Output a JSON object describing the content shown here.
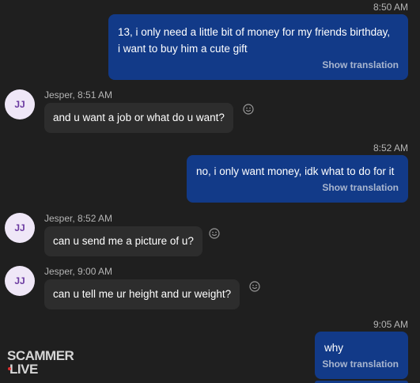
{
  "messages": [
    {
      "type": "timestamp",
      "text": "8:50 AM"
    },
    {
      "type": "outgoing",
      "text": "13, i only need a little bit of money for my friends birthday,\ni want to buy him a cute gift",
      "translation": "Show translation"
    },
    {
      "type": "incoming",
      "sender_meta": "Jesper, 8:51 AM",
      "avatar": "JJ",
      "text": "and u want a job or what do u want?"
    },
    {
      "type": "timestamp",
      "text": "8:52 AM"
    },
    {
      "type": "outgoing",
      "text": "no, i only want money, idk what to do for it",
      "translation": "Show translation"
    },
    {
      "type": "incoming",
      "sender_meta": "Jesper, 8:52 AM",
      "avatar": "JJ",
      "text": "can u send me a picture of u?"
    },
    {
      "type": "incoming",
      "sender_meta": "Jesper, 9:00 AM",
      "avatar": "JJ",
      "text": "can u tell me ur height and ur weight?"
    },
    {
      "type": "timestamp",
      "text": "9:05 AM"
    },
    {
      "type": "outgoing",
      "text": "why",
      "translation": "Show translation"
    }
  ],
  "watermark": {
    "line1": "SCAMMER",
    "line2": "LIVE"
  },
  "colors": {
    "background": "#1f1f1f",
    "outgoing_bubble": "#123a88",
    "incoming_bubble": "#2d2d2d",
    "avatar_bg": "#efe7f7",
    "avatar_text": "#6b3aa0",
    "watermark_dot": "#e03030"
  },
  "icons": {
    "reaction": "smiley-icon"
  }
}
